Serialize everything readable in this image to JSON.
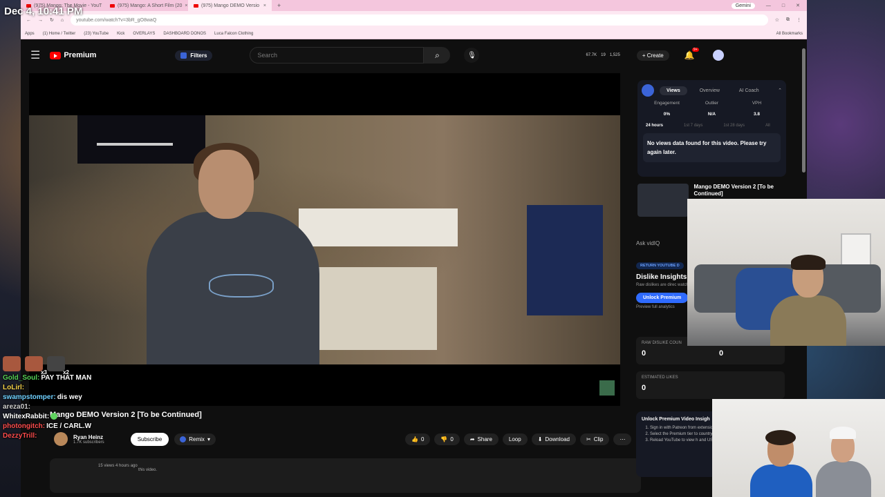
{
  "overlay": {
    "clock": "Dec 4, 10:41 PM"
  },
  "browser": {
    "tabs": [
      {
        "title": "(975) Mango: The Movie - YouT"
      },
      {
        "title": "(975) Mango: A Short Film (20"
      },
      {
        "title": "(975) Mango DEMO Versio"
      }
    ],
    "gemini": "Gemini",
    "url": "youtube.com/watch?v=3bR_gO8waQ",
    "bookmarks": [
      "Apps",
      "(1) Home / Twitter",
      "(23) YouTube",
      "Kick",
      "OVERLAYS",
      "DASHBOARD DONOS",
      "Luca Falcon Clothing"
    ],
    "all_bookmarks": "All Bookmarks"
  },
  "yt": {
    "logo": "Premium",
    "filters": "Filters",
    "search_placeholder": "Search",
    "stats": [
      "67.7K",
      "19",
      "1,525"
    ],
    "create": "Create",
    "notif_badge": "9+"
  },
  "video": {
    "title": "Mango DEMO Version 2 [To be Continued]",
    "channel": "Ryan Heinz",
    "subs": "1.7K subscribers",
    "subscribe": "Subscribe",
    "remix": "Remix",
    "likes": "0",
    "dislikes": "0",
    "share": "Share",
    "loop": "Loop",
    "download": "Download",
    "clip": "Clip",
    "meta": "15 views  4 hours ago",
    "desc_tail": "this video."
  },
  "vidiq": {
    "tabs": [
      "Views",
      "Overview",
      "AI Coach"
    ],
    "metrics": [
      {
        "label": "Engagement",
        "value": "0%"
      },
      {
        "label": "Outlier",
        "value": "N/A"
      },
      {
        "label": "VPH",
        "value": "3.8"
      }
    ],
    "ranges": [
      "24 hours",
      "1st 7 days",
      "1st 28 days",
      "All"
    ],
    "nodata": "No views data found for this video. Please try again later.",
    "next_title": "Mango DEMO Version 2 [To be Continued]",
    "ask": "Ask vidIQ",
    "return_badge": "RETURN YOUTUBE D",
    "dislike_heading": "Dislike Insights",
    "dislike_sub": "Raw dislikes are direc watching this video.",
    "unlock_btn": "Unlock Premium",
    "preview": "Preview full analytics",
    "raw_label": "RAW DISLIKE COUN",
    "raw_values": [
      "0",
      "0"
    ],
    "est_label": "ESTIMATED LIKES",
    "est_value": "0",
    "unlock_title": "Unlock Premium Video Insigh",
    "unlock_items": [
      "Sign in with Patreon from extension popup.",
      "Select the Premium tier to country leaderboards, and",
      "Reload YouTube to view h and US state drill-downs f"
    ]
  },
  "chat": [
    {
      "user": "Gold_Soul:",
      "text": "PAY THAT MAN",
      "color": "#56d156"
    },
    {
      "user": "LoLirl:",
      "text": "",
      "color": "#f5d34a"
    },
    {
      "user": "swampstomper:",
      "text": "dis wey",
      "color": "#6fd0ff"
    },
    {
      "user": "areza01:",
      "text": "",
      "color": "#cfcfcf"
    },
    {
      "user": "WhitexRabbit:",
      "text": "",
      "color": "#ffffff"
    },
    {
      "user": "photongitch:",
      "text": "ICE / CARL.W",
      "color": "#ff4d4d"
    },
    {
      "user": "DezzyTrill:",
      "text": "",
      "color": "#ff4d4d"
    }
  ],
  "emote_counts": [
    "x3",
    "x2"
  ]
}
